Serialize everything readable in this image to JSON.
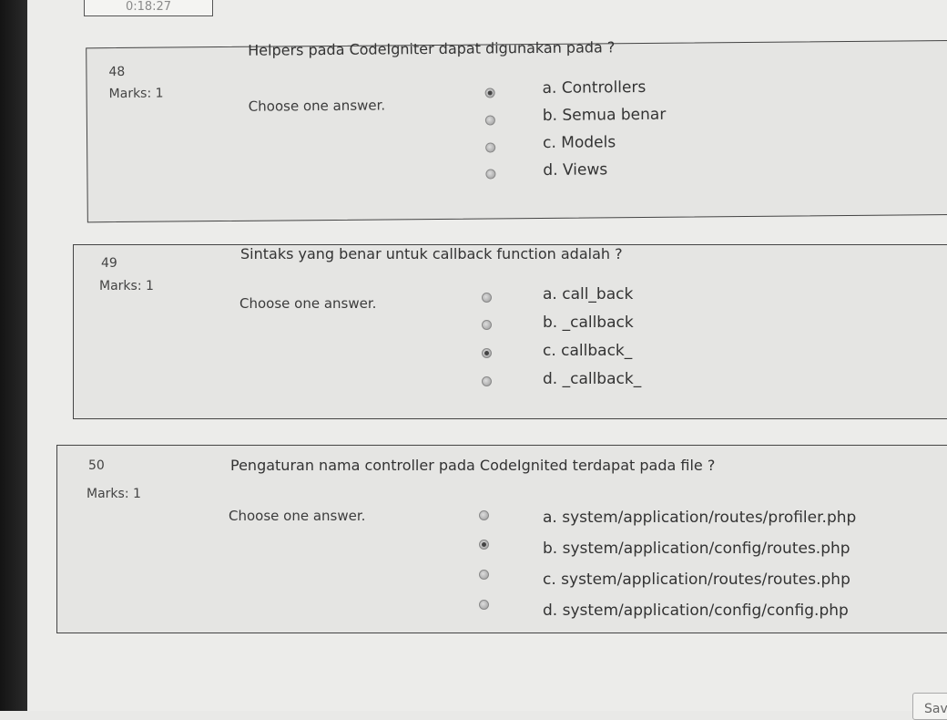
{
  "timer": "0:18:27",
  "questions": [
    {
      "number": "48",
      "marks": "Marks: 1",
      "text": "Helpers pada CodeIgniter dapat digunakan pada ?",
      "choose": "Choose one answer.",
      "options": [
        {
          "label": "a. Controllers",
          "checked": true
        },
        {
          "label": "b. Semua benar",
          "checked": false
        },
        {
          "label": "c. Models",
          "checked": false
        },
        {
          "label": "d. Views",
          "checked": false
        }
      ]
    },
    {
      "number": "49",
      "marks": "Marks: 1",
      "text": "Sintaks yang benar untuk callback function adalah ?",
      "choose": "Choose one answer.",
      "options": [
        {
          "label": "a. call_back",
          "checked": false
        },
        {
          "label": "b. _callback",
          "checked": false
        },
        {
          "label": "c. callback_",
          "checked": true
        },
        {
          "label": "d. _callback_",
          "checked": false
        }
      ]
    },
    {
      "number": "50",
      "marks": "Marks: 1",
      "text": "Pengaturan nama controller pada CodeIgnited terdapat pada file ?",
      "choose": "Choose one answer.",
      "options": [
        {
          "label": "a. system/application/routes/profiler.php",
          "checked": false
        },
        {
          "label": "b. system/application/config/routes.php",
          "checked": true
        },
        {
          "label": "c. system/application/routes/routes.php",
          "checked": false
        },
        {
          "label": "d. system/application/config/config.php",
          "checked": false
        }
      ]
    }
  ],
  "save_button": "Save w"
}
